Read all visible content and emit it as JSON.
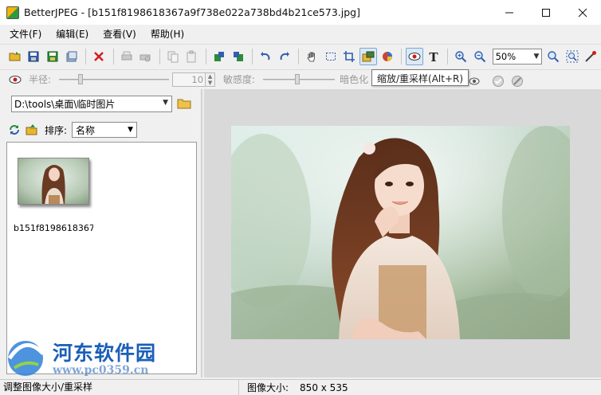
{
  "window": {
    "title": "BetterJPEG - [b151f8198618367a9f738e022a738bd4b21ce573.jpg]"
  },
  "menu": {
    "items": [
      {
        "label": "文件(F)"
      },
      {
        "label": "编辑(E)"
      },
      {
        "label": "查看(V)"
      },
      {
        "label": "帮助(H)"
      }
    ]
  },
  "toolbar": {
    "zoom_value": "50%"
  },
  "toolbar2": {
    "radius_label": "半径:",
    "radius_value": "10",
    "sensitivity_label": "敏感度:",
    "darken_label": "暗色化"
  },
  "tooltip": {
    "text": "缩放/重采样(Alt+R)"
  },
  "browser": {
    "path": "D:\\tools\\桌面\\临时图片",
    "sort_label": "排序:",
    "sort_value": "名称",
    "thumbnails": [
      {
        "caption": "b151f8198618367..."
      }
    ]
  },
  "status": {
    "hint": "调整图像大小/重采样",
    "size_label": "图像大小:",
    "size_value": "850 x 535"
  },
  "watermark": {
    "name": "河东软件园",
    "url": "www.pc0359.cn"
  },
  "colors": {
    "accent": "#1b5fb8",
    "red_delete": "#d11f1f"
  }
}
